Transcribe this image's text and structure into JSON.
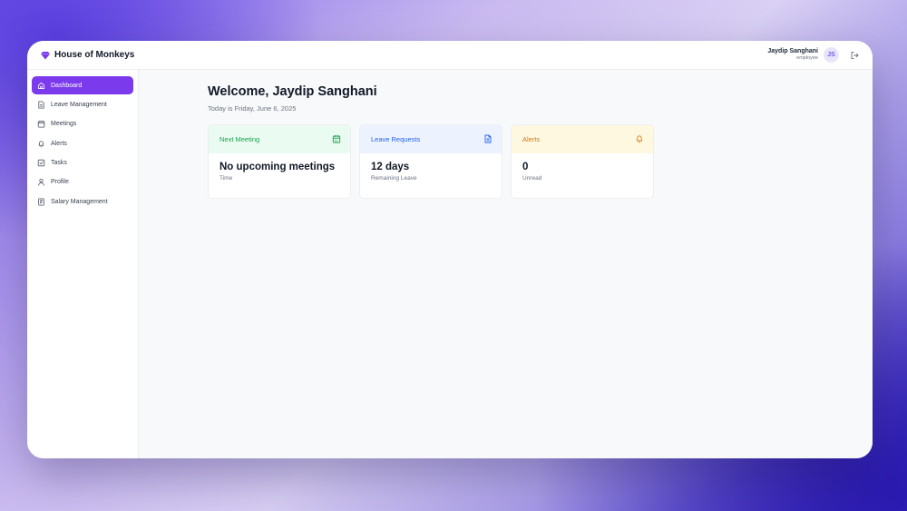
{
  "app": {
    "name": "House of Monkeys",
    "brand_icon": "gem-icon",
    "brand_color": "#7c3aed"
  },
  "user": {
    "name": "Jaydip Sanghani",
    "role": "employee",
    "initials": "JS"
  },
  "sidebar": {
    "items": [
      {
        "label": "Dashboard",
        "icon": "home-icon",
        "active": true
      },
      {
        "label": "Leave Management",
        "icon": "document-icon"
      },
      {
        "label": "Meetings",
        "icon": "calendar-icon"
      },
      {
        "label": "Alerts",
        "icon": "bell-icon"
      },
      {
        "label": "Tasks",
        "icon": "checkbox-icon"
      },
      {
        "label": "Profile",
        "icon": "user-icon"
      },
      {
        "label": "Salary Management",
        "icon": "receipt-icon"
      }
    ]
  },
  "main": {
    "title": "Welcome, Jaydip Sanghani",
    "date": "Today is Friday, June 6, 2025",
    "cards": [
      {
        "title": "Next Meeting",
        "value": "No upcoming meetings",
        "sub": "Time",
        "icon": "calendar-icon",
        "color": "#16a34a"
      },
      {
        "title": "Leave Requests",
        "value": "12 days",
        "sub": "Remaining Leave",
        "icon": "document-icon",
        "color": "#2563eb"
      },
      {
        "title": "Alerts",
        "value": "0",
        "sub": "Unread",
        "icon": "bell-icon",
        "color": "#d97706"
      }
    ]
  }
}
